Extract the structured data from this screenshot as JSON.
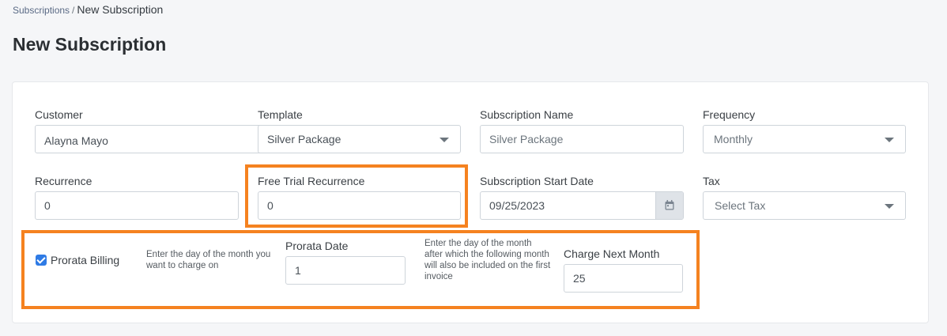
{
  "breadcrumb": {
    "parent": "Subscriptions",
    "separator": "/",
    "current": "New Subscription"
  },
  "page": {
    "title": "New Subscription"
  },
  "form": {
    "customer": {
      "label": "Customer",
      "value": "Alayna Mayo"
    },
    "template": {
      "label": "Template",
      "value": "Silver Package"
    },
    "subscription_name": {
      "label": "Subscription Name",
      "value": "Silver Package"
    },
    "frequency": {
      "label": "Frequency",
      "value": "Monthly"
    },
    "recurrence": {
      "label": "Recurrence",
      "value": "0"
    },
    "free_trial_recurrence": {
      "label": "Free Trial Recurrence",
      "value": "0"
    },
    "start_date": {
      "label": "Subscription Start Date",
      "value": "09/25/2023"
    },
    "tax": {
      "label": "Tax",
      "placeholder": "Select Tax"
    },
    "prorata_billing": {
      "label": "Prorata Billing",
      "checked": true,
      "help": "Enter the day of the month you want to charge on"
    },
    "prorata_date": {
      "label": "Prorata Date",
      "value": "1",
      "help": "Enter the day of the month after which the following month will also be included on the first invoice"
    },
    "charge_next_month": {
      "label": "Charge Next Month",
      "value": "25"
    }
  },
  "colors": {
    "highlight": "#f58220",
    "checkbox": "#2f7be5"
  },
  "icons": {
    "calendar": "calendar-icon",
    "dropdown": "chevron-down-icon",
    "check": "checkmark-icon"
  }
}
